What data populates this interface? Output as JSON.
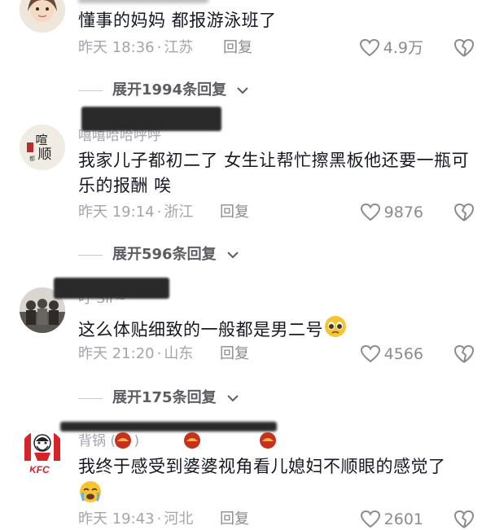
{
  "comments": [
    {
      "username": "",
      "text": "懂事的妈妈 都报游泳班了",
      "time": "昨天 18:36",
      "location": "江苏",
      "reply_label": "回复",
      "likes": "4.9万"
    },
    {
      "username": "嘻嘻哈哈呼呼",
      "text": "我家儿子都初二了  女生让帮忙擦黑板他还要一瓶可乐的报酬  唉",
      "time": "昨天 19:14",
      "location": "浙江",
      "reply_label": "回复",
      "likes": "9876"
    },
    {
      "username": "叮 Sir~",
      "text": "这么体贴细致的一般都是男二号",
      "time": "昨天 21:20",
      "location": "山东",
      "reply_label": "回复",
      "likes": "4566"
    },
    {
      "username": "背锅      (加      )",
      "text": "我终于感受到婆婆视角看儿媳妇不顺眼的感觉了",
      "time": "昨天 19:43",
      "location": "河北",
      "reply_label": "回复",
      "likes": "2601"
    }
  ],
  "expanders": [
    {
      "label": "展开1994条回复"
    },
    {
      "label": "展开596条回复"
    },
    {
      "label": "展开175条回复"
    }
  ],
  "dot": "·",
  "avatar4_label": "KFC",
  "colors": {
    "meta": "#a3a5ac",
    "text": "#161823",
    "kfc_red": "#d6232a"
  }
}
